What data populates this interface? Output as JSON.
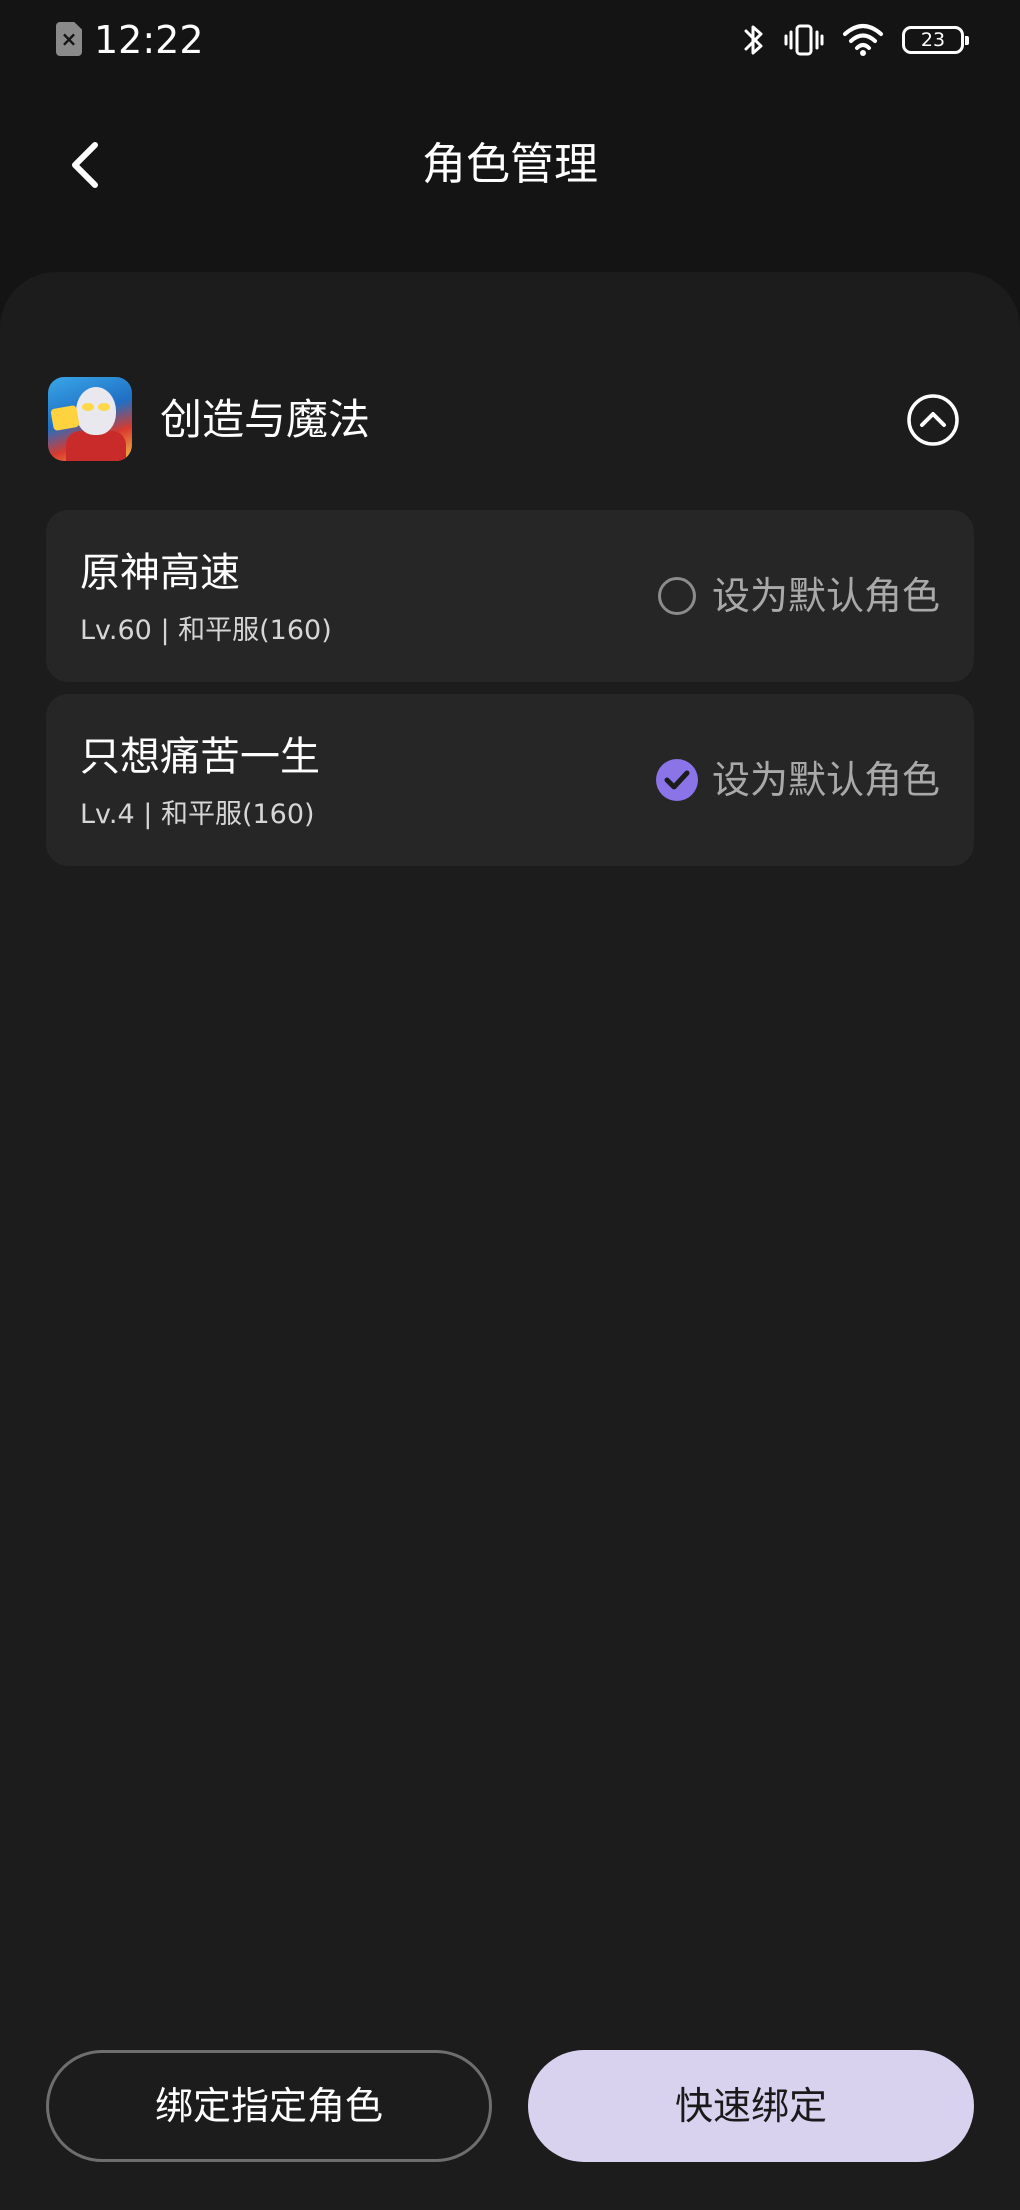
{
  "status_bar": {
    "time": "12:22",
    "battery": "23",
    "sim_label": "×"
  },
  "header": {
    "title": "角色管理",
    "back_icon": "chevron-left-icon"
  },
  "game": {
    "name": "创造与魔法",
    "collapse_icon": "chevron-up-circle-icon"
  },
  "roles": [
    {
      "name": "原神高速",
      "meta": "Lv.60 | 和平服(160)",
      "toggle_label": "设为默认角色",
      "is_default": false
    },
    {
      "name": "只想痛苦一生",
      "meta": "Lv.4 | 和平服(160)",
      "toggle_label": "设为默认角色",
      "is_default": true
    }
  ],
  "actions": {
    "bind_specific_label": "绑定指定角色",
    "quick_bind_label": "快速绑定"
  },
  "colors": {
    "accent": "#8b74e8",
    "primary_button": "#d8d2ef",
    "background": "#141414",
    "card": "#262626"
  }
}
